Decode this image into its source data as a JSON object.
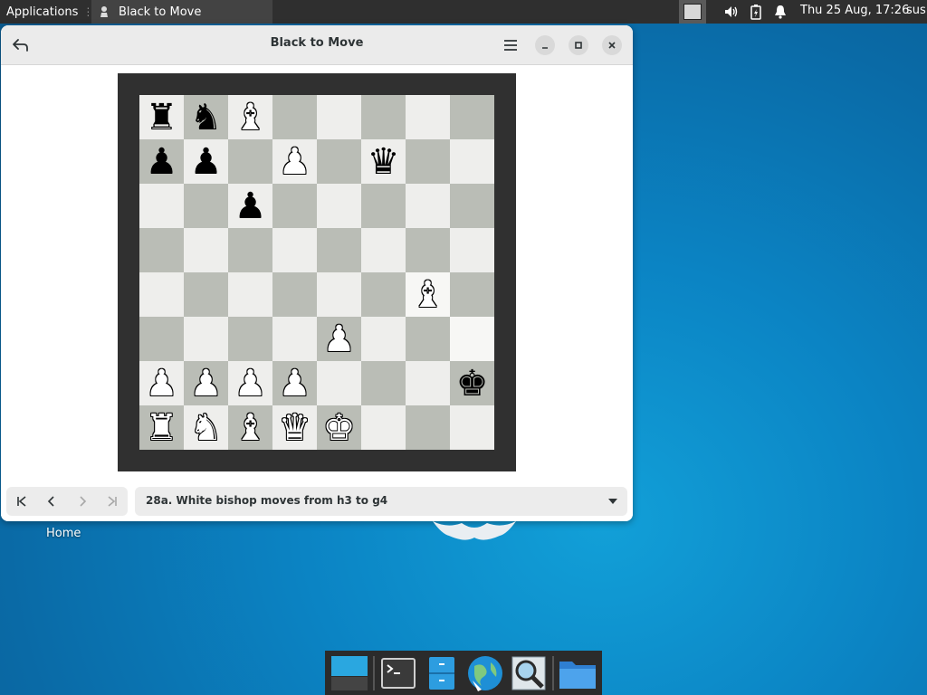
{
  "panel": {
    "applications_label": "Applications",
    "task_title": "Black to Move",
    "clock": "Thu 25 Aug, 17:26",
    "user": "sus"
  },
  "window": {
    "title": "Black to Move",
    "history_text": "28a. White bishop moves from h3 to g4"
  },
  "board": {
    "rows": [
      [
        {
          "c": "b",
          "p": "♜"
        },
        {
          "c": "b",
          "p": "♞"
        },
        {
          "c": "w",
          "p": "♝"
        },
        null,
        null,
        null,
        null,
        null
      ],
      [
        {
          "c": "b",
          "p": "♟"
        },
        {
          "c": "b",
          "p": "♟"
        },
        null,
        {
          "c": "w",
          "p": "♟"
        },
        null,
        {
          "c": "b",
          "p": "♛"
        },
        null,
        null
      ],
      [
        null,
        null,
        {
          "c": "b",
          "p": "♟"
        },
        null,
        null,
        null,
        null,
        null
      ],
      [
        null,
        null,
        null,
        null,
        null,
        null,
        null,
        null
      ],
      [
        null,
        null,
        null,
        null,
        null,
        null,
        {
          "c": "w",
          "p": "♝"
        },
        null
      ],
      [
        null,
        null,
        null,
        null,
        {
          "c": "w",
          "p": "♟"
        },
        null,
        null,
        null
      ],
      [
        {
          "c": "w",
          "p": "♟"
        },
        {
          "c": "w",
          "p": "♟"
        },
        {
          "c": "w",
          "p": "♟"
        },
        {
          "c": "w",
          "p": "♟"
        },
        null,
        null,
        null,
        {
          "c": "b",
          "p": "♚"
        }
      ],
      [
        {
          "c": "w",
          "p": "♜"
        },
        {
          "c": "w",
          "p": "♞"
        },
        {
          "c": "w",
          "p": "♝"
        },
        {
          "c": "w",
          "p": "♛"
        },
        {
          "c": "w",
          "p": "♚"
        },
        null,
        null,
        null
      ]
    ],
    "highlight": [
      "h3",
      "g4"
    ]
  },
  "desktop": {
    "home_label": "Home"
  },
  "dock": {
    "items": [
      "workspace-switcher-icon",
      "terminal-icon",
      "file-cabinet-icon",
      "web-browser-icon",
      "search-icon",
      "folder-icon"
    ]
  },
  "colors": {
    "light_square": "#eeeeec",
    "dark_square": "#babdb6",
    "board_frame": "#303030"
  }
}
